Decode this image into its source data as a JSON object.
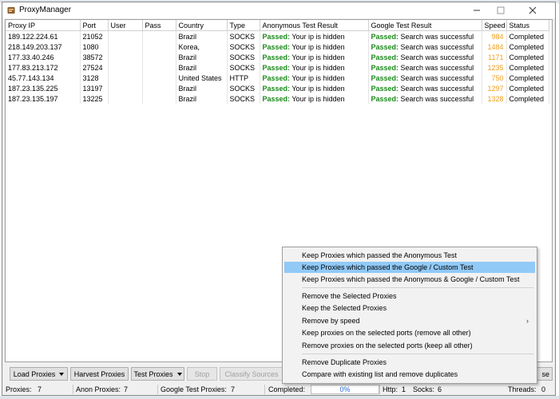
{
  "window": {
    "title": "ProxyManager"
  },
  "table": {
    "columns": [
      "Proxy IP",
      "Port",
      "User",
      "Pass",
      "Country",
      "Type",
      "Anonymous Test Result",
      "Google Test Result",
      "Speed",
      "Status"
    ],
    "rows": [
      {
        "ip": "189.122.224.61",
        "port": "21052",
        "user": "",
        "pass": "",
        "country": "Brazil",
        "type": "SOCKS",
        "anon_status": "Passed:",
        "anon_msg": " Your ip is hidden",
        "google_status": "Passed:",
        "google_msg": " Search was successful",
        "speed": "984",
        "status": "Completed"
      },
      {
        "ip": "218.149.203.137",
        "port": "1080",
        "user": "",
        "pass": "",
        "country": "Korea,",
        "type": "SOCKS",
        "anon_status": "Passed:",
        "anon_msg": " Your ip is hidden",
        "google_status": "Passed:",
        "google_msg": " Search was successful",
        "speed": "1484",
        "status": "Completed"
      },
      {
        "ip": "177.33.40.246",
        "port": "38572",
        "user": "",
        "pass": "",
        "country": "Brazil",
        "type": "SOCKS",
        "anon_status": "Passed:",
        "anon_msg": " Your ip is hidden",
        "google_status": "Passed:",
        "google_msg": " Search was successful",
        "speed": "1171",
        "status": "Completed"
      },
      {
        "ip": "177.83.213.172",
        "port": "27524",
        "user": "",
        "pass": "",
        "country": "Brazil",
        "type": "SOCKS",
        "anon_status": "Passed:",
        "anon_msg": " Your ip is hidden",
        "google_status": "Passed:",
        "google_msg": " Search was successful",
        "speed": "1235",
        "status": "Completed"
      },
      {
        "ip": "45.77.143.134",
        "port": "3128",
        "user": "",
        "pass": "",
        "country": "United States",
        "type": "HTTP",
        "anon_status": "Passed:",
        "anon_msg": " Your ip is hidden",
        "google_status": "Passed:",
        "google_msg": " Search was successful",
        "speed": "750",
        "status": "Completed"
      },
      {
        "ip": "187.23.135.225",
        "port": "13197",
        "user": "",
        "pass": "",
        "country": "Brazil",
        "type": "SOCKS",
        "anon_status": "Passed:",
        "anon_msg": " Your ip is hidden",
        "google_status": "Passed:",
        "google_msg": " Search was successful",
        "speed": "1297",
        "status": "Completed"
      },
      {
        "ip": "187.23.135.197",
        "port": "13225",
        "user": "",
        "pass": "",
        "country": "Brazil",
        "type": "SOCKS",
        "anon_status": "Passed:",
        "anon_msg": " Your ip is hidden",
        "google_status": "Passed:",
        "google_msg": " Search was successful",
        "speed": "1328",
        "status": "Completed"
      }
    ]
  },
  "toolbar": {
    "load_proxies": "Load Proxies",
    "harvest_proxies": "Harvest Proxies",
    "test_proxies": "Test Proxies",
    "stop": "Stop",
    "classify_sources": "Classify Sources",
    "close_partial": "se"
  },
  "context_menu": {
    "items": [
      "Keep Proxies which passed the Anonymous Test",
      "Keep Proxies which passed the Google / Custom Test",
      "Keep Proxies which passed the Anonymous & Google / Custom Test",
      "Remove the Selected Proxies",
      "Keep the Selected Proxies",
      "Remove by speed",
      "Keep proxies on the selected ports (remove all other)",
      "Remove proxies on the selected ports (keep all other)",
      "Remove Duplicate Proxies",
      "Compare with existing list and remove duplicates"
    ],
    "active_index": 1
  },
  "status": {
    "proxies_label": "Proxies:",
    "proxies": "7",
    "anon_label": "Anon Proxies:",
    "anon": "7",
    "google_label": "Google Test Proxies:",
    "google": "7",
    "completed_label": "Completed:",
    "completed": "0%",
    "http_label": "Http:",
    "http": "1",
    "socks_label": "Socks:",
    "socks": "6",
    "threads_label": "Threads:",
    "threads": "0"
  },
  "colors": {
    "passed": "#1a8a1a",
    "speed": "#f0a020",
    "menu_highlight": "#91c9f7"
  },
  "icons": {
    "app": "proxy-manager-app-icon",
    "submenu": "chevron-right-icon"
  }
}
